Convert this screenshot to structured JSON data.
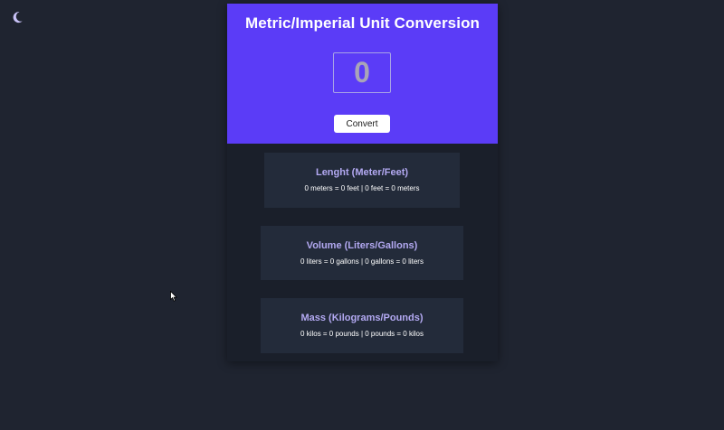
{
  "theme": {
    "page_bg": "#1f2430",
    "panel_bg": "#1a1f2a",
    "accent": "#5b3cf7",
    "card_bg": "#232b3a",
    "card_title_color": "#b3a9f2",
    "toggle_icon": "moon-icon"
  },
  "header": {
    "title": "Metric/Imperial Unit Conversion",
    "input_value": "0",
    "convert_label": "Convert"
  },
  "results": [
    {
      "title": "Lenght (Meter/Feet)",
      "line": "0 meters = 0 feet | 0 feet = 0 meters"
    },
    {
      "title": "Volume (Liters/Gallons)",
      "line": "0 liters = 0 gallons | 0 gallons = 0 liters"
    },
    {
      "title": "Mass (Kilograms/Pounds)",
      "line": "0 kilos = 0 pounds | 0 pounds = 0 kilos"
    }
  ]
}
